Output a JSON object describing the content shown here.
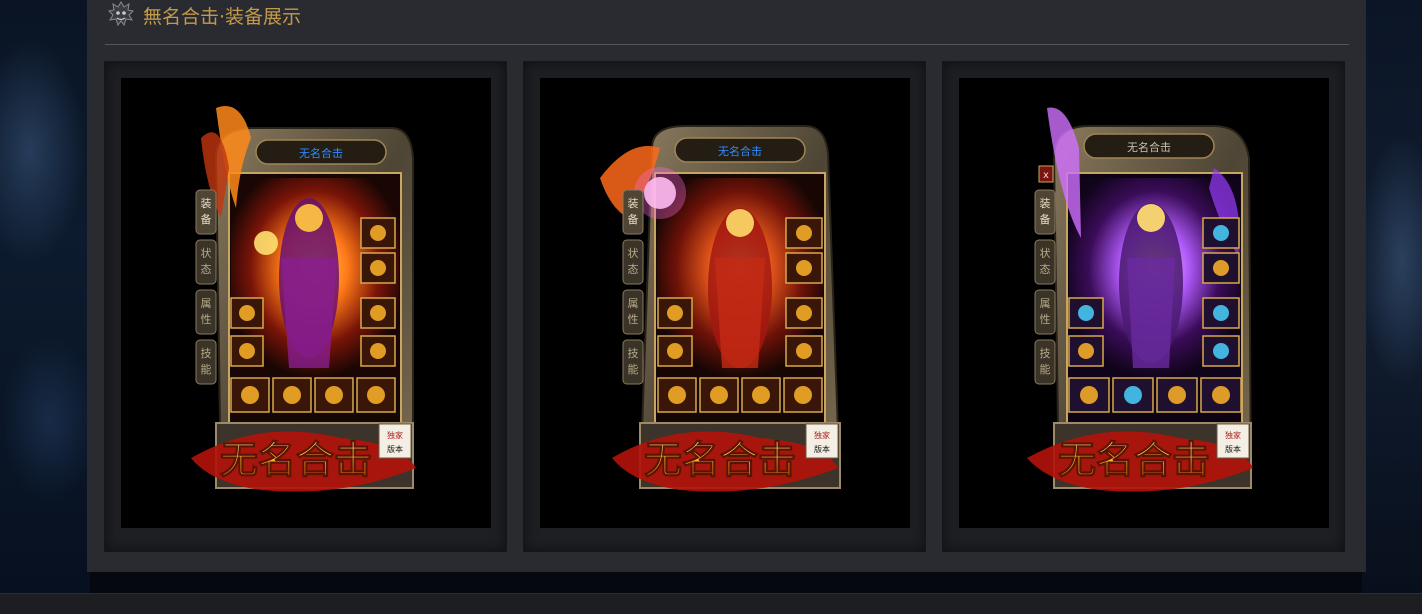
{
  "section": {
    "title": "無名合击·装备展示",
    "icon": "demon-head-icon"
  },
  "cards": [
    {
      "window_title": "无名合击",
      "title_color": "#2e8cff",
      "tabs": [
        "装备",
        "状态",
        "属性",
        "技能"
      ],
      "logo_text": "无名合击",
      "badge_text": "独家版本",
      "theme": "fire-orange",
      "accent": "#ff7a18"
    },
    {
      "window_title": "无名合击",
      "title_color": "#2e8cff",
      "tabs": [
        "装备",
        "状态",
        "属性",
        "技能"
      ],
      "logo_text": "无名合击",
      "badge_text": "独家版本",
      "theme": "crimson-gold",
      "accent": "#d8381c"
    },
    {
      "window_title": "无名合击",
      "title_color": "#c8c2b0",
      "tabs": [
        "装备",
        "状态",
        "属性",
        "技能"
      ],
      "logo_text": "无名合击",
      "badge_text": "独家版本",
      "theme": "violet-gold",
      "accent": "#b45cff"
    }
  ]
}
